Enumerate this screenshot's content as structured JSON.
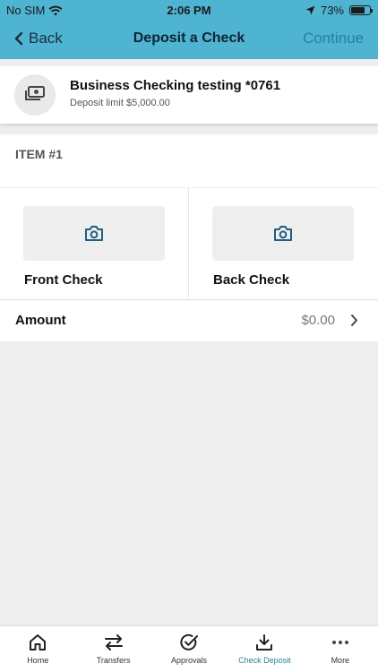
{
  "status_bar": {
    "carrier": "No SIM",
    "time": "2:06 PM",
    "battery": "73%",
    "battery_level": 0.73
  },
  "nav": {
    "back_label": "Back",
    "title": "Deposit a Check",
    "continue_label": "Continue"
  },
  "account": {
    "name": "Business Checking testing *0761",
    "limit": "Deposit limit $5,000.00"
  },
  "item": {
    "label": "ITEM #1",
    "front_label": "Front Check",
    "back_label": "Back Check",
    "amount_label": "Amount",
    "amount_value": "$0.00"
  },
  "tabs": [
    {
      "label": "Home",
      "icon": "home-icon"
    },
    {
      "label": "Transfers",
      "icon": "transfer-icon"
    },
    {
      "label": "Approvals",
      "icon": "check-circle-icon"
    },
    {
      "label": "Check Deposit",
      "icon": "download-icon",
      "active": true
    },
    {
      "label": "More",
      "icon": "more-icon"
    }
  ],
  "colors": {
    "accent": "#4fb3d2",
    "active": "#2b7f9a",
    "icon_blue": "#1d5f7f"
  }
}
